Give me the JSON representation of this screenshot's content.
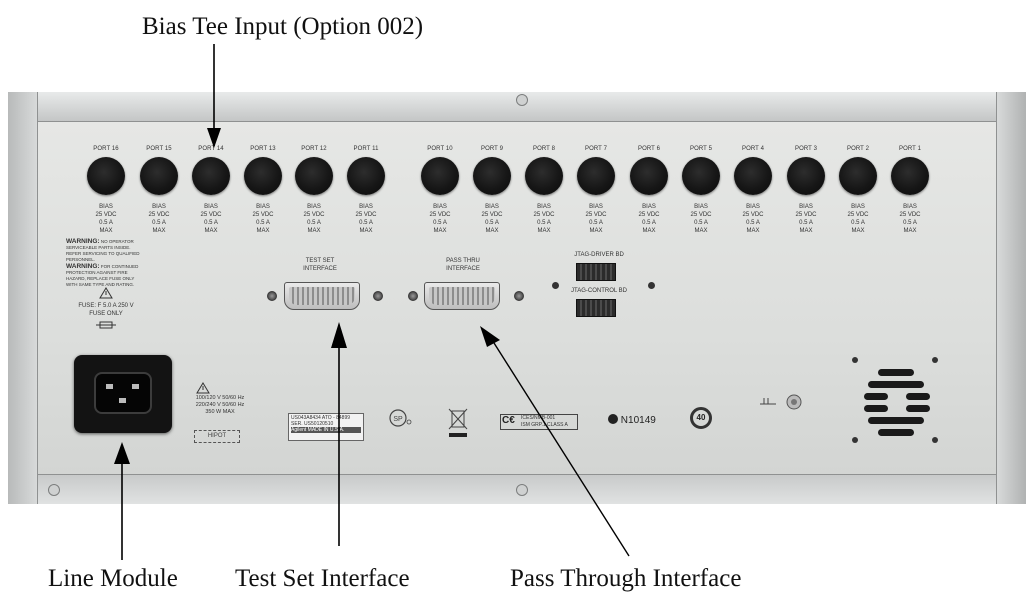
{
  "callouts": {
    "bias_tee": "Bias Tee Input (Option 002)",
    "line_module": "Line Module",
    "test_set": "Test Set Interface",
    "pass_through": "Pass Through Interface"
  },
  "ports": [
    {
      "label": "PORT 16",
      "bias": "BIAS\n25 VDC\n0.5 A\nMAX"
    },
    {
      "label": "PORT 15",
      "bias": "BIAS\n25 VDC\n0.5 A\nMAX"
    },
    {
      "label": "PORT 14",
      "bias": "BIAS\n25 VDC\n0.5 A\nMAX"
    },
    {
      "label": "PORT 13",
      "bias": "BIAS\n25 VDC\n0.5 A\nMAX"
    },
    {
      "label": "PORT 12",
      "bias": "BIAS\n25 VDC\n0.5 A\nMAX"
    },
    {
      "label": "PORT 11",
      "bias": "BIAS\n25 VDC\n0.5 A\nMAX"
    },
    {
      "label": "PORT 10",
      "bias": "BIAS\n25 VDC\n0.5 A\nMAX"
    },
    {
      "label": "PORT 9",
      "bias": "BIAS\n25 VDC\n0.5 A\nMAX"
    },
    {
      "label": "PORT 8",
      "bias": "BIAS\n25 VDC\n0.5 A\nMAX"
    },
    {
      "label": "PORT 7",
      "bias": "BIAS\n25 VDC\n0.5 A\nMAX"
    },
    {
      "label": "PORT 6",
      "bias": "BIAS\n25 VDC\n0.5 A\nMAX"
    },
    {
      "label": "PORT 5",
      "bias": "BIAS\n25 VDC\n0.5 A\nMAX"
    },
    {
      "label": "PORT 4",
      "bias": "BIAS\n25 VDC\n0.5 A\nMAX"
    },
    {
      "label": "PORT 3",
      "bias": "BIAS\n25 VDC\n0.5 A\nMAX"
    },
    {
      "label": "PORT 2",
      "bias": "BIAS\n25 VDC\n0.5 A\nMAX"
    },
    {
      "label": "PORT 1",
      "bias": "BIAS\n25 VDC\n0.5 A\nMAX"
    }
  ],
  "panel": {
    "warning1_title": "WARNING:",
    "warning1_text": "NO OPERATOR SERVICEABLE PARTS INSIDE. REFER SERVICING TO QUALIFIED PERSONNEL.",
    "warning2_title": "WARNING:",
    "warning2_text": "FOR CONTINUED PROTECTION AGAINST FIRE HAZARD, REPLACE FUSE ONLY WITH SAME TYPE AND RATING.",
    "fuse_text": "FUSE: F 5.0 A  250 V\nFUSE ONLY",
    "test_set_label": "TEST SET\nINTERFACE",
    "pass_thru_label": "PASS THRU\nINTERFACE",
    "jtag_driver": "JTAG-DRIVER BD",
    "jtag_control": "JTAG-CONTROL BD",
    "power_rating": "100/120 V  50/60 Hz\n220/240 V  50/60 Hz\n350 W MAX",
    "hipot": "HIPOT",
    "serial_line1": "US043A8434    ATO - 84899",
    "serial_line2": "SER. US50120510",
    "serial_line3": "Agilent  MADE IN U.S.A.",
    "ce_text": "ICES/NMB-001\nISM GRP.1 CLASS A",
    "c_tick": "N10149",
    "eco_number": "40"
  },
  "colors": {
    "panel": "#dfe0de",
    "frame": "#c9cbcb",
    "connector": "#161616",
    "text": "#111111"
  }
}
